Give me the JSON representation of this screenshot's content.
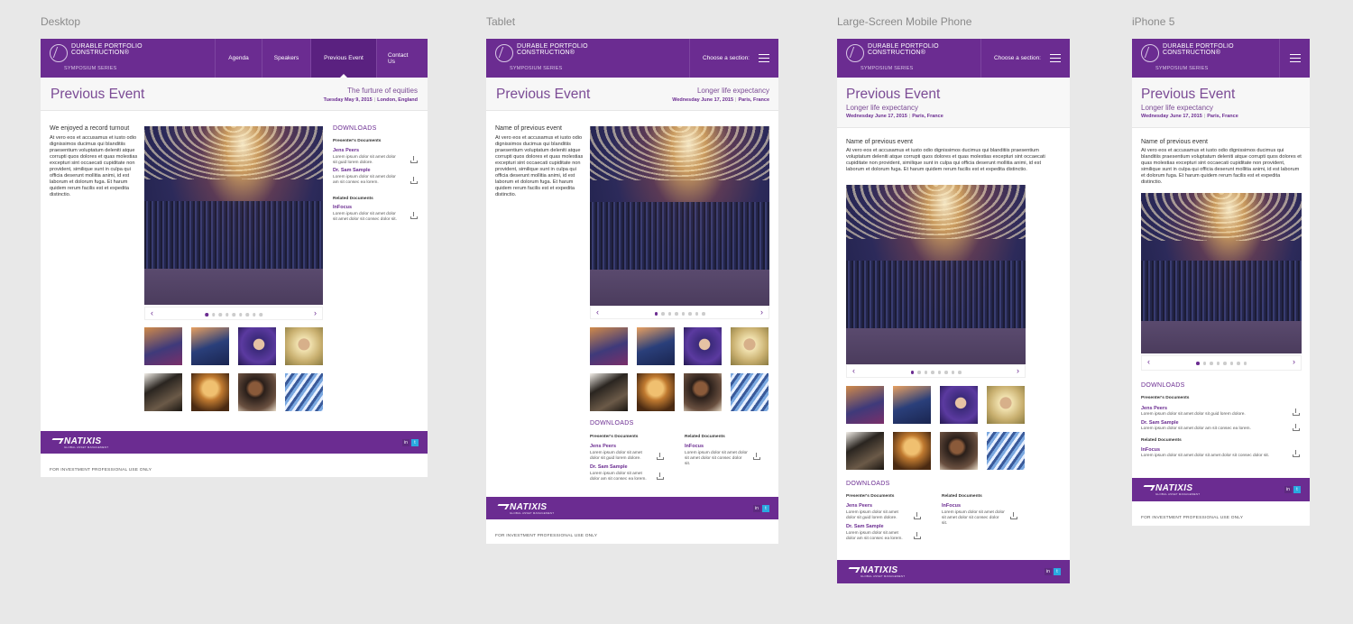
{
  "labels": {
    "desktop": "Desktop",
    "tablet": "Tablet",
    "large_mobile": "Large-Screen Mobile Phone",
    "iphone": "iPhone 5"
  },
  "brand": {
    "logo_line": "DURABLE PORTFOLIO CONSTRUCTION®",
    "logo_sub": "SYMPOSIUM SERIES",
    "footer_logo": "NATIXIS",
    "footer_tag": "GLOBAL ASSET MANAGEMENT",
    "primary_color": "#6b2c91"
  },
  "nav": [
    "Agenda",
    "Speakers",
    "Previous Event",
    "Contact Us"
  ],
  "choose_section": "Choose a section:",
  "page_title": "Previous Event",
  "desktop_event": {
    "subtitle": "The furture of equities",
    "date": "Tuesday May 9, 2015",
    "location": "London, England",
    "heading": "We enjoyed a record turnout"
  },
  "mobile_event": {
    "subtitle": "Longer life expectancy",
    "date": "Wednesday June 17, 2015",
    "location": "Paris, France",
    "heading": "Name of previous event"
  },
  "body_text": "At vero eos et accusamus et iusto odio dignissimos ducimus qui blanditiis praesentium voluptatum deleniti atque corrupti quos dolores et quas molestias excepturi sint occaecati cupiditate non provident, similique sunt in culpa qui officia deserunt mollitia animi, id est laborum et dolorum fuga. Et harum quidem rerum facilis est et expedita distinctio.",
  "downloads": {
    "heading": "DOWNLOADS",
    "presenters_label": "Presenter's Documents",
    "related_label": "Related Documents",
    "items": [
      {
        "name": "Jens Peers",
        "desc": "Lorem ipsum dolor sit amet dolor sit guid lorem dolore."
      },
      {
        "name": "Dr. Sam Sample",
        "desc": "Lorem ipsum dolor sit amet dolor am sit consec ea lorem."
      }
    ],
    "related": [
      {
        "name": "InFocus",
        "desc": "Lorem ipsum dolor sit amet dolor sit amet dolor sit consec dolor sit."
      }
    ]
  },
  "legal": "FOR INVESTMENT PROFESSIONAL USE ONLY",
  "social": {
    "linkedin": "in",
    "twitter": "t"
  },
  "carousel": {
    "total": 9,
    "active": 1,
    "prev": "‹",
    "next": "›"
  }
}
